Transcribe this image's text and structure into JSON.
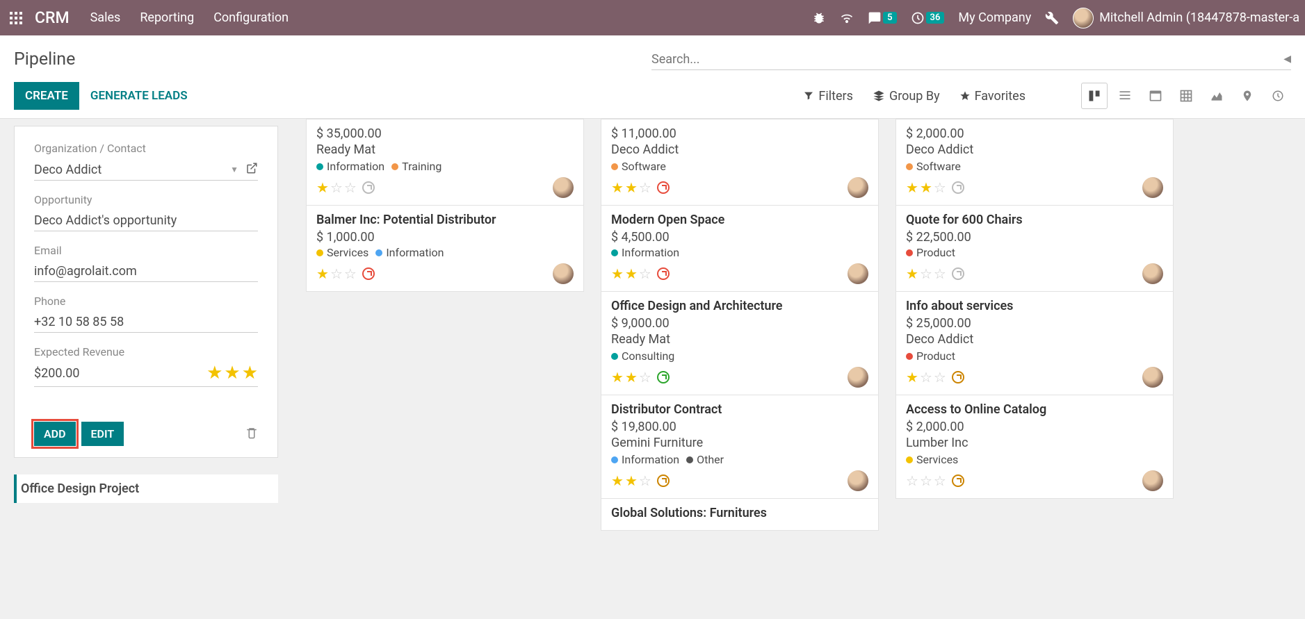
{
  "navbar": {
    "brand": "CRM",
    "menus": [
      "Sales",
      "Reporting",
      "Configuration"
    ],
    "messages_badge": "5",
    "activities_badge": "36",
    "company": "My Company",
    "user": "Mitchell Admin (18447878-master-a"
  },
  "control_panel": {
    "breadcrumb": "Pipeline",
    "search_placeholder": "Search...",
    "create_label": "CREATE",
    "generate_label": "GENERATE LEADS",
    "filters_label": "Filters",
    "groupby_label": "Group By",
    "favorites_label": "Favorites"
  },
  "quick_create": {
    "org_label": "Organization / Contact",
    "org_value": "Deco Addict",
    "opp_label": "Opportunity",
    "opp_value": "Deco Addict's opportunity",
    "email_label": "Email",
    "email_value": "info@agrolait.com",
    "phone_label": "Phone",
    "phone_value": "+32 10 58 85 58",
    "revenue_label": "Expected Revenue",
    "revenue_value": "$200.00",
    "priority": 3,
    "add_label": "ADD",
    "edit_label": "EDIT",
    "below_card": "Office Design Project"
  },
  "columns": [
    {
      "cards": [
        {
          "title": "",
          "amount": "$ 35,000.00",
          "subtitle": "Ready Mat",
          "tags": [
            {
              "name": "Information",
              "color": "dot-blue"
            },
            {
              "name": "Training",
              "color": "dot-orange"
            }
          ],
          "stars": 1,
          "clock": "grey"
        },
        {
          "title": "Balmer Inc: Potential Distributor",
          "amount": "$ 1,000.00",
          "subtitle": "",
          "tags": [
            {
              "name": "Services",
              "color": "dot-yellow"
            },
            {
              "name": "Information",
              "color": "dot-lblue"
            }
          ],
          "stars": 1,
          "clock": "red"
        }
      ]
    },
    {
      "cards": [
        {
          "title": "",
          "amount": "$ 11,000.00",
          "subtitle": "Deco Addict",
          "tags": [
            {
              "name": "Software",
              "color": "dot-orange"
            }
          ],
          "stars": 2,
          "clock": "red"
        },
        {
          "title": "Modern Open Space",
          "amount": "$ 4,500.00",
          "subtitle": "",
          "tags": [
            {
              "name": "Information",
              "color": "dot-blue"
            }
          ],
          "stars": 2,
          "clock": "red"
        },
        {
          "title": "Office Design and Architecture",
          "amount": "$ 9,000.00",
          "subtitle": "Ready Mat",
          "tags": [
            {
              "name": "Consulting",
              "color": "dot-blue"
            }
          ],
          "stars": 2,
          "clock": "green"
        },
        {
          "title": "Distributor Contract",
          "amount": "$ 19,800.00",
          "subtitle": "Gemini Furniture",
          "tags": [
            {
              "name": "Information",
              "color": "dot-lblue"
            },
            {
              "name": "Other",
              "color": "dot-grey"
            }
          ],
          "stars": 2,
          "clock": "orange"
        },
        {
          "title": "Global Solutions: Furnitures",
          "amount": "",
          "subtitle": "",
          "tags": [],
          "stars": 0,
          "clock": ""
        }
      ]
    },
    {
      "cards": [
        {
          "title": "",
          "amount": "$ 2,000.00",
          "subtitle": "Deco Addict",
          "tags": [
            {
              "name": "Software",
              "color": "dot-orange"
            }
          ],
          "stars": 2,
          "clock": "grey"
        },
        {
          "title": "Quote for 600 Chairs",
          "amount": "$ 22,500.00",
          "subtitle": "",
          "tags": [
            {
              "name": "Product",
              "color": "dot-red"
            }
          ],
          "stars": 1,
          "clock": "grey"
        },
        {
          "title": "Info about services",
          "amount": "$ 25,000.00",
          "subtitle": "Deco Addict",
          "tags": [
            {
              "name": "Product",
              "color": "dot-red"
            }
          ],
          "stars": 1,
          "clock": "orange"
        },
        {
          "title": "Access to Online Catalog",
          "amount": "$ 2,000.00",
          "subtitle": "Lumber Inc",
          "tags": [
            {
              "name": "Services",
              "color": "dot-yellow"
            }
          ],
          "stars": 0,
          "clock": "orange"
        }
      ]
    }
  ]
}
